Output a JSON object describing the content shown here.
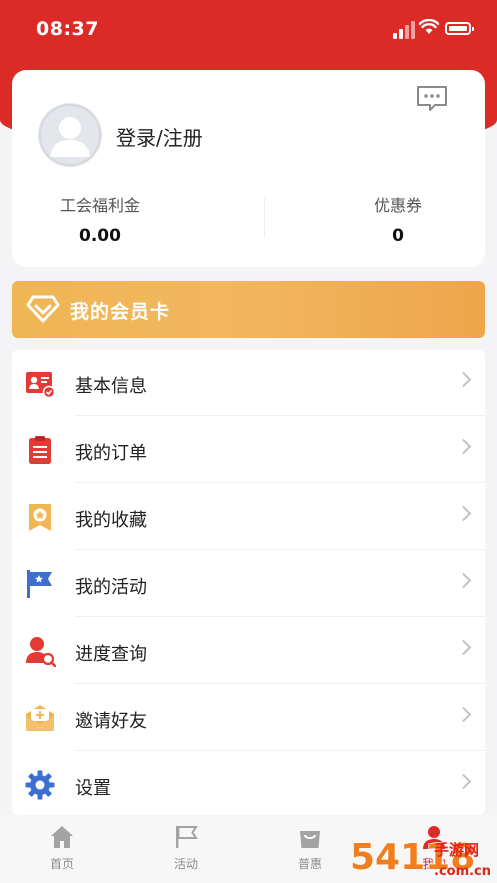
{
  "status": {
    "time": "08:37"
  },
  "profile": {
    "login_label": "登录/注册",
    "stats": [
      {
        "label": "工会福利金",
        "value": "0.00"
      },
      {
        "label": "优惠券",
        "value": "0"
      }
    ]
  },
  "member_card": {
    "label": "我的会员卡"
  },
  "menu": [
    {
      "label": "基本信息",
      "icon": "id-card-icon"
    },
    {
      "label": "我的订单",
      "icon": "clipboard-icon"
    },
    {
      "label": "我的收藏",
      "icon": "bookmark-star-icon"
    },
    {
      "label": "我的活动",
      "icon": "flag-icon"
    },
    {
      "label": "进度查询",
      "icon": "user-search-icon"
    },
    {
      "label": "邀请好友",
      "icon": "invite-envelope-icon"
    },
    {
      "label": "设置",
      "icon": "gear-icon"
    }
  ],
  "tabs": [
    {
      "label": "首页",
      "icon": "home-icon"
    },
    {
      "label": "活动",
      "icon": "flag-icon"
    },
    {
      "label": "普惠",
      "icon": "shopping-bag-icon"
    },
    {
      "label": "我的",
      "icon": "user-icon",
      "active": true
    }
  ],
  "watermark": {
    "text": "54118 手游网 .com.cn"
  },
  "colors": {
    "brand_red": "#dc2b26",
    "gold": "#efb653",
    "tab_inactive": "#8c8c8c"
  }
}
